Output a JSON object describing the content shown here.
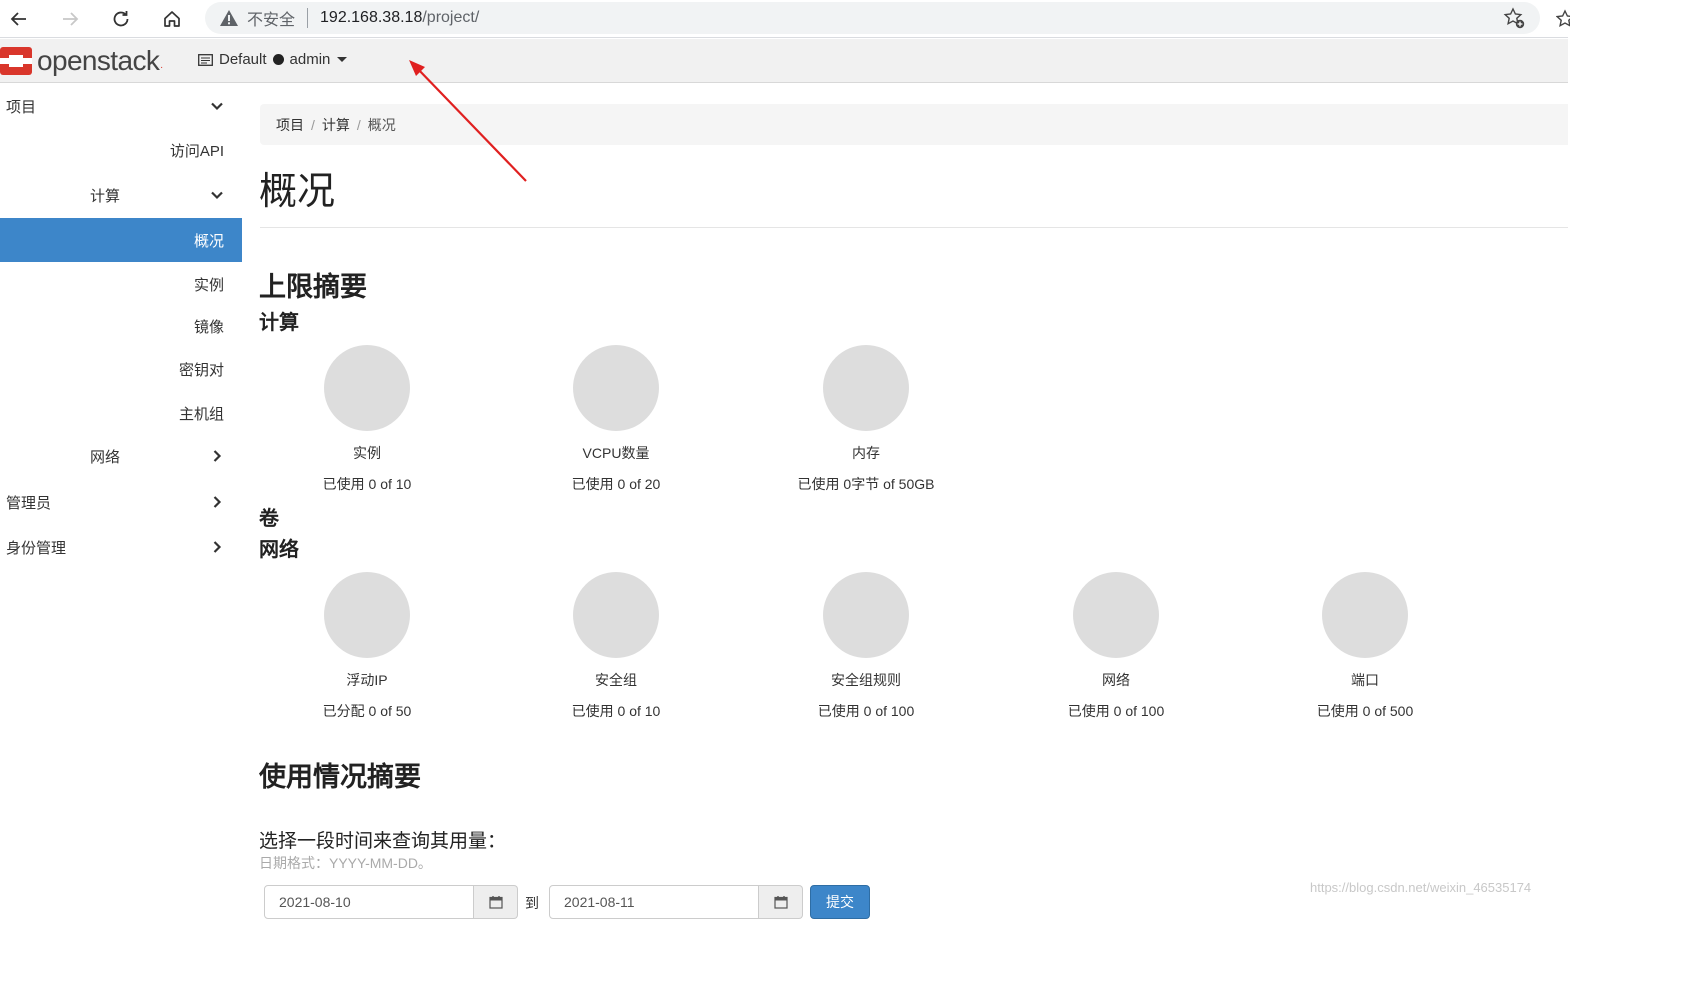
{
  "browser": {
    "insecure_label": "不安全",
    "url_host": "192.168.38.18",
    "url_path": "/project/"
  },
  "header": {
    "logo_text": "openstack",
    "logo_mark": ".",
    "domain": "Default",
    "user": "admin"
  },
  "sidebar": {
    "items": [
      {
        "label": "项目",
        "level": 0,
        "chevron": "down"
      },
      {
        "label": "访问API",
        "level": 2
      },
      {
        "label": "计算",
        "level": 1,
        "chevron": "down"
      },
      {
        "label": "概况",
        "level": 2,
        "active": true
      },
      {
        "label": "实例",
        "level": 2
      },
      {
        "label": "镜像",
        "level": 2
      },
      {
        "label": "密钥对",
        "level": 2
      },
      {
        "label": "主机组",
        "level": 2
      },
      {
        "label": "网络",
        "level": 1,
        "chevron": "right"
      },
      {
        "label": "管理员",
        "level": 0,
        "chevron": "right"
      },
      {
        "label": "身份管理",
        "level": 0,
        "chevron": "right"
      }
    ]
  },
  "breadcrumb": [
    "项目",
    "计算",
    "概况"
  ],
  "breadcrumb_sep": "/",
  "page_title": "概况",
  "limits": {
    "heading": "上限摘要",
    "compute_heading": "计算",
    "compute": [
      {
        "name": "实例",
        "usage": "已使用 0 of 10"
      },
      {
        "name": "VCPU数量",
        "usage": "已使用 0 of 20"
      },
      {
        "name": "内存",
        "usage": "已使用 0字节 of 50GB"
      }
    ],
    "volume_heading": "卷",
    "network_heading": "网络",
    "network": [
      {
        "name": "浮动IP",
        "usage": "已分配 0 of 50"
      },
      {
        "name": "安全组",
        "usage": "已使用 0 of 10"
      },
      {
        "name": "安全组规则",
        "usage": "已使用 0 of 100"
      },
      {
        "name": "网络",
        "usage": "已使用 0 of 100"
      },
      {
        "name": "端口",
        "usage": "已使用 0 of 500"
      }
    ]
  },
  "usage": {
    "heading": "使用情况摘要",
    "query_label": "选择一段时间来查询其用量：",
    "help_text": "日期格式：YYYY-MM-DD。",
    "start_date": "2021-08-10",
    "to_label": "到",
    "end_date": "2021-08-11",
    "submit_label": "提交"
  },
  "watermark": "https://blog.csdn.net/weixin_46535174",
  "colors": {
    "accent": "#3d86c9",
    "logo_red": "#d9362b",
    "pie_empty": "#dddddd",
    "annotation_arrow": "#e02020"
  }
}
